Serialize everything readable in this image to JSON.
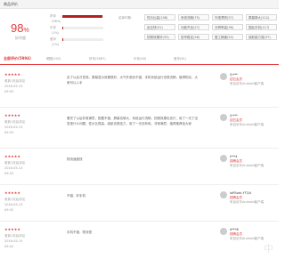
{
  "header": {
    "title": "商品评价"
  },
  "rating": {
    "percent": "98",
    "percent_sign": "%",
    "label": "好评度"
  },
  "breakdown": [
    {
      "label": "好评",
      "percent": "(98%)",
      "value": 0.98
    },
    {
      "label": "中评",
      "percent": "(1%)",
      "value": 0.01
    },
    {
      "label": "差评",
      "percent": "(1%)",
      "value": 0.01
    }
  ],
  "impressions": {
    "title": "买家印象：",
    "tags": [
      "性价比高(108)",
      "系统流畅(75)",
      "外观漂亮(57)",
      "屏幕够大(112)",
      "反应快(31)",
      "功能齐全(27)",
      "分辨率高(36)",
      "国民手机(117)",
      "拍照效果好(33)",
      "信号稳定(28)",
      "做工精细(52)",
      "续航能力强(37)"
    ]
  },
  "filters": {
    "all": "全部评价(5994)",
    "tabs": [
      "晒图(202)",
      "好评(5887)",
      "中评(46)",
      "差评(61)"
    ]
  },
  "reviews": [
    {
      "stars": "★★★★★",
      "source": "收到1天后评论",
      "date": "2016-05-13",
      "time": "09:55",
      "text": "买了以后才发现，屏幕显示效果很好，大气外观也不错，手机系统运行也很流畅，值得购买，大家可以入手",
      "user": "小***",
      "level": "钻石会员",
      "client": "来自京东Android客户端"
    },
    {
      "stars": "★★★★★",
      "source": "收到1天后评论",
      "date": "2016-05-13",
      "time": "09:33",
      "text": "看完了以后非常满意，配置不错，屏幕也够大，系统运行流畅，拍照效果也还行，用了一天了没发现什么问题，性价比很高，续航也很给力，用了一天还有电，非常满意，值得推荐给大家",
      "user": "小***",
      "level": "钻石会员",
      "client": "来自京东Android客户端"
    },
    {
      "stars": "★★★★★",
      "source": "收到1天后评论",
      "date": "2016-05-13",
      "time": "09:33",
      "text": "物流速度快",
      "user": "j***4",
      "level": "铜牌会员",
      "client": "来自京东Android客户端"
    },
    {
      "stars": "★★★★★",
      "source": "收到1天后评论",
      "date": "2016-05-13",
      "time": "09:33",
      "text": "不错，好手机",
      "user": "loPSsek.YTQU",
      "level": "铜牌会员",
      "client": "来自京东Android客户端"
    },
    {
      "stars": "★★★★★",
      "source": "收到1天后评论",
      "date": "2016-05-13",
      "time": "09:42",
      "text": "手机不错，物流很",
      "user": "d***8",
      "level": "铜牌会员",
      "client": "来自京东Android客户端"
    }
  ],
  "watermark": "中"
}
